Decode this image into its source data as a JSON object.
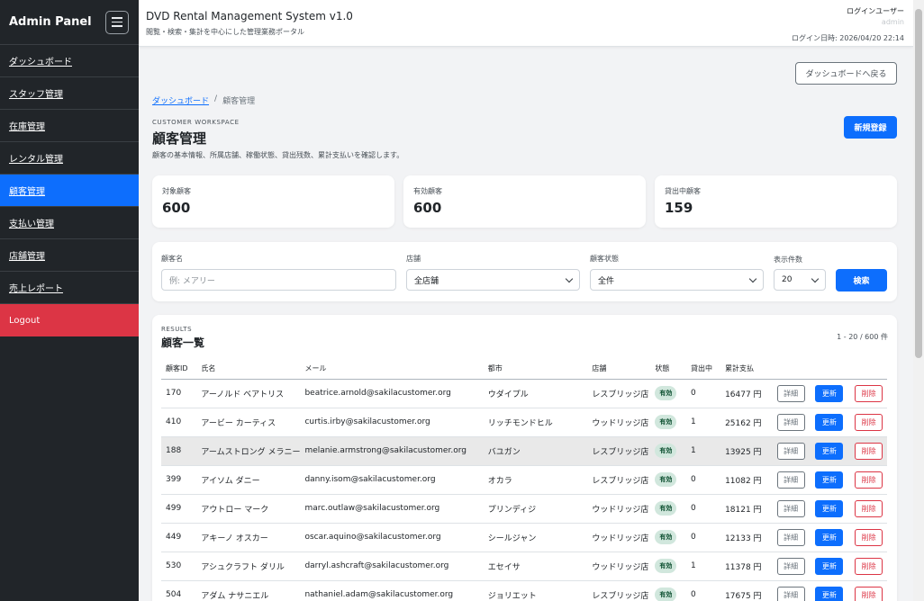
{
  "sidebar": {
    "brand": "Admin Panel",
    "items": [
      {
        "label": "ダッシュボード"
      },
      {
        "label": "スタッフ管理"
      },
      {
        "label": "在庫管理"
      },
      {
        "label": "レンタル管理"
      },
      {
        "label": "顧客管理"
      },
      {
        "label": "支払い管理"
      },
      {
        "label": "店舗管理"
      },
      {
        "label": "売上レポート"
      }
    ],
    "active_index": 4,
    "logout": "Logout"
  },
  "header": {
    "title": "DVD Rental Management System v1.0",
    "subtitle": "閲覧・検索・集計を中心にした管理業務ポータル",
    "user_label": "ログインユーザー",
    "user_name": "admin",
    "login_time": "ログイン日時: 2026/04/20 22:14"
  },
  "main": {
    "back_button": "ダッシュボードへ戻る",
    "breadcrumb": {
      "link": "ダッシュボード",
      "separator": "/",
      "current": "顧客管理"
    },
    "eyebrow": "CUSTOMER WORKSPACE",
    "title": "顧客管理",
    "description": "顧客の基本情報、所属店舗、稼働状態、貸出残数、累計支払いを確認します。",
    "new_button": "新規登録"
  },
  "stats": [
    {
      "label": "対象顧客",
      "value": "600"
    },
    {
      "label": "有効顧客",
      "value": "600"
    },
    {
      "label": "貸出中顧客",
      "value": "159"
    }
  ],
  "filters": {
    "name_label": "顧客名",
    "name_placeholder": "例: メアリー",
    "store_label": "店舗",
    "store_value": "全店舗",
    "status_label": "顧客状態",
    "status_value": "全件",
    "count_label": "表示件数",
    "count_value": "20",
    "search_button": "検索"
  },
  "results": {
    "eyebrow": "RESULTS",
    "title": "顧客一覧",
    "range": "1 - 20 / 600 件",
    "headers": [
      "顧客ID",
      "氏名",
      "メール",
      "都市",
      "店舗",
      "状態",
      "貸出中",
      "累計支払"
    ],
    "action_labels": {
      "detail": "詳細",
      "update": "更新",
      "delete": "削除"
    },
    "highlighted_row": 2,
    "rows": [
      {
        "id": "170",
        "name": "アーノルド ベアトリス",
        "email": "beatrice.arnold@sakilacustomer.org",
        "city": "ウダイプル",
        "store": "レスブリッジ店",
        "status": "有効",
        "rentals": "0",
        "paid": "16477 円"
      },
      {
        "id": "410",
        "name": "アービー カーティス",
        "email": "curtis.irby@sakilacustomer.org",
        "city": "リッチモンドヒル",
        "store": "ウッドリッジ店",
        "status": "有効",
        "rentals": "1",
        "paid": "25162 円"
      },
      {
        "id": "188",
        "name": "アームストロング メラニー",
        "email": "melanie.armstrong@sakilacustomer.org",
        "city": "バユガン",
        "store": "レスブリッジ店",
        "status": "有効",
        "rentals": "1",
        "paid": "13925 円"
      },
      {
        "id": "399",
        "name": "アイソム ダニー",
        "email": "danny.isom@sakilacustomer.org",
        "city": "オカラ",
        "store": "レスブリッジ店",
        "status": "有効",
        "rentals": "0",
        "paid": "11082 円"
      },
      {
        "id": "499",
        "name": "アウトロー マーク",
        "email": "marc.outlaw@sakilacustomer.org",
        "city": "プリンディジ",
        "store": "ウッドリッジ店",
        "status": "有効",
        "rentals": "0",
        "paid": "18121 円"
      },
      {
        "id": "449",
        "name": "アキーノ オスカー",
        "email": "oscar.aquino@sakilacustomer.org",
        "city": "シールジャン",
        "store": "ウッドリッジ店",
        "status": "有効",
        "rentals": "0",
        "paid": "12133 円"
      },
      {
        "id": "530",
        "name": "アシュクラフト ダリル",
        "email": "darryl.ashcraft@sakilacustomer.org",
        "city": "エセイサ",
        "store": "ウッドリッジ店",
        "status": "有効",
        "rentals": "1",
        "paid": "11378 円"
      },
      {
        "id": "504",
        "name": "アダム ナサニエル",
        "email": "nathaniel.adam@sakilacustomer.org",
        "city": "ジョリエット",
        "store": "レスブリッジ店",
        "status": "有効",
        "rentals": "0",
        "paid": "17675 円"
      }
    ]
  },
  "colors": {
    "primary": "#0d6efd",
    "danger": "#dc3545",
    "sidebar_bg": "#212529",
    "badge_bg": "#d1e7dd",
    "badge_text": "#0f5132"
  }
}
